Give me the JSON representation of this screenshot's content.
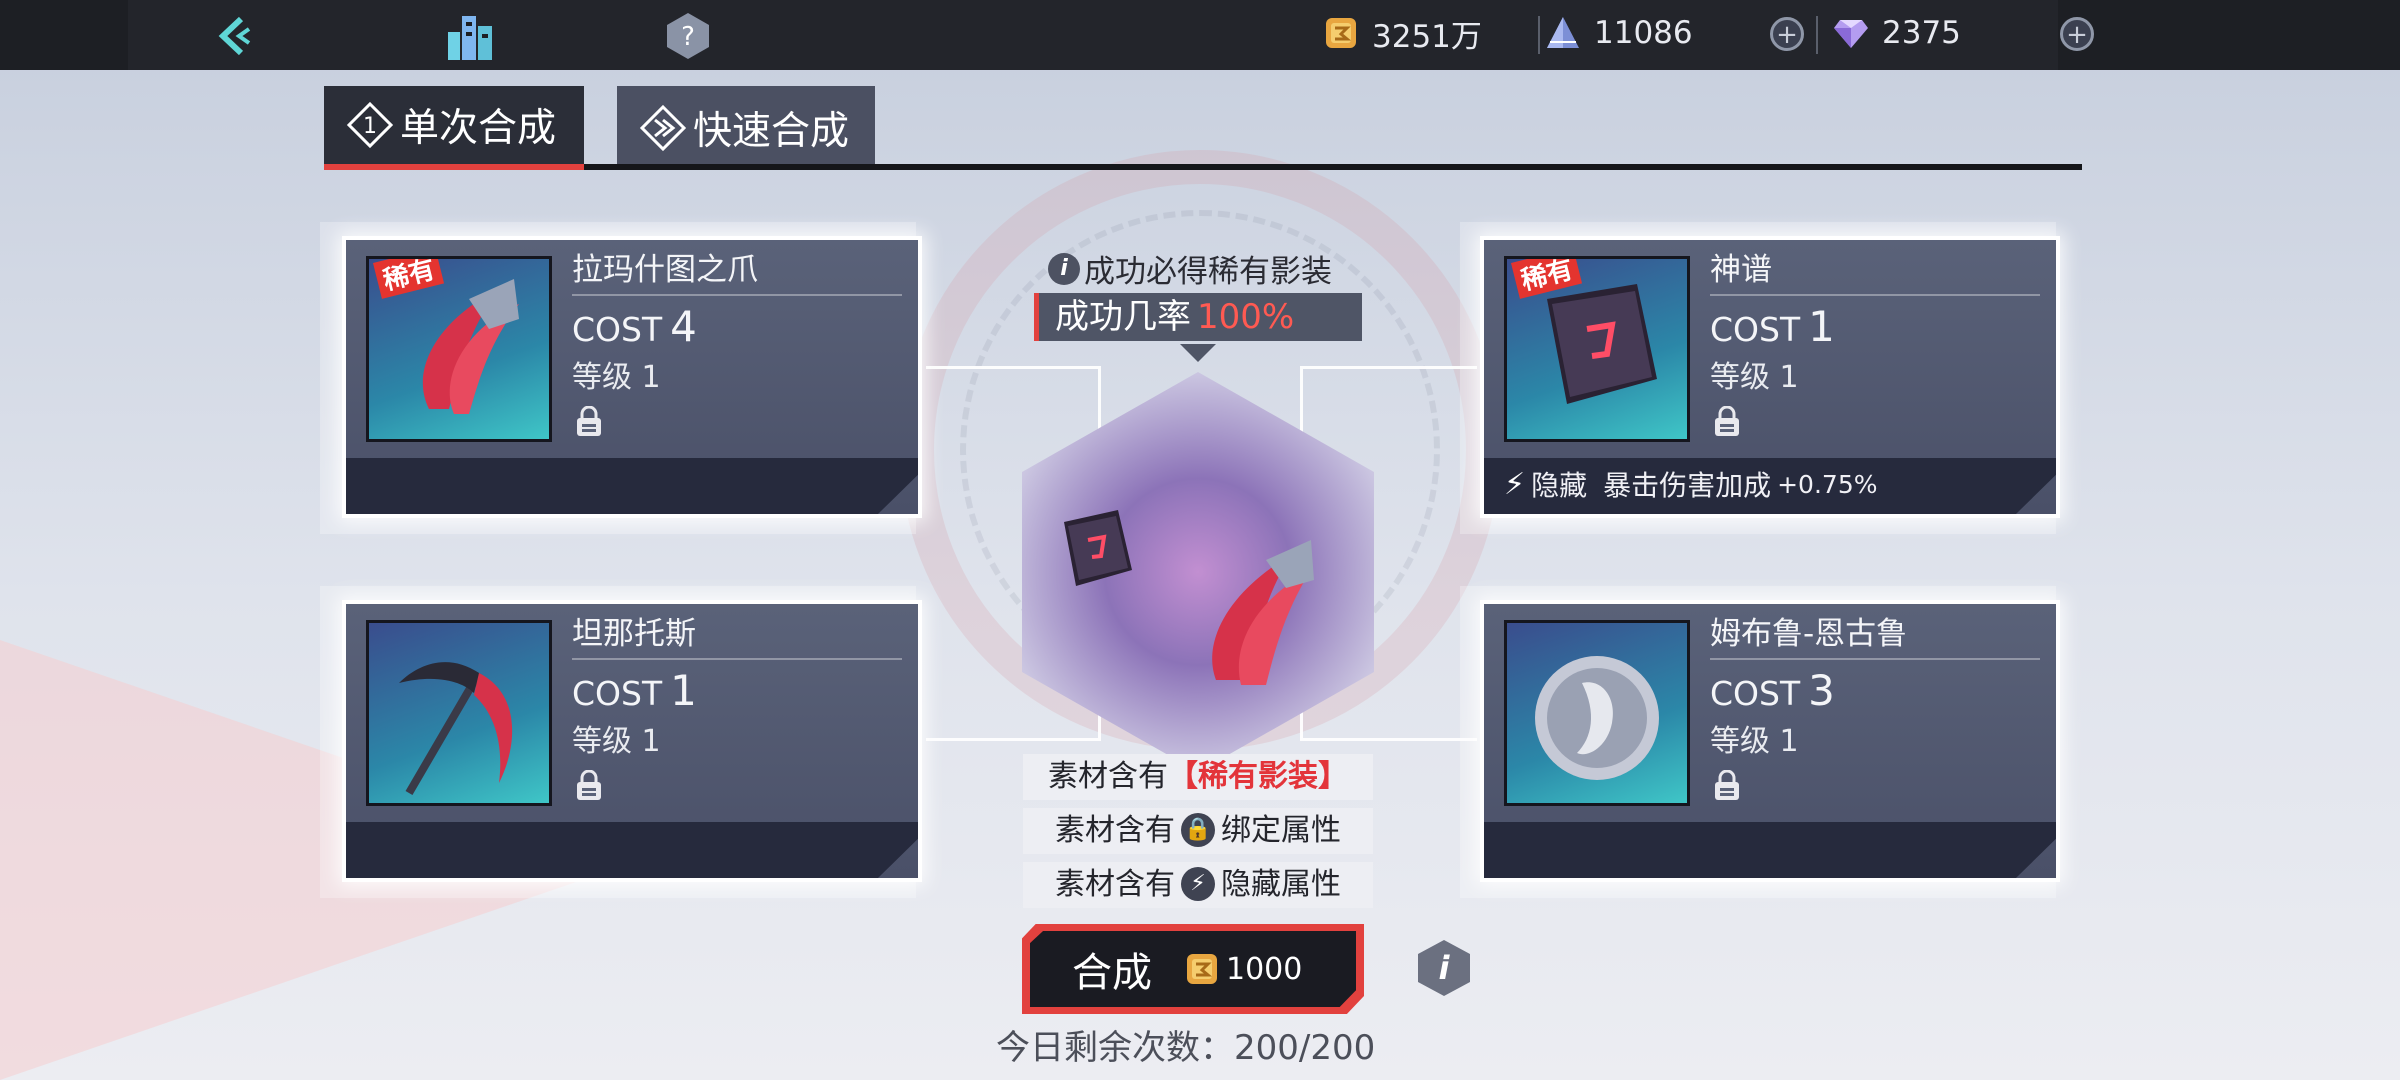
{
  "topbar": {
    "resources": [
      {
        "icon": "gold-coin-icon",
        "value": "3251万"
      },
      {
        "icon": "crystal-pyramid-icon",
        "value": "11086"
      },
      {
        "icon": "diamond-icon",
        "value": "2375"
      }
    ],
    "plus_label": "+"
  },
  "tabs": [
    {
      "label": "单次合成",
      "icon": "single-synthesis-icon",
      "active": true
    },
    {
      "label": "快速合成",
      "icon": "quick-synthesis-icon",
      "active": false
    }
  ],
  "cards": [
    {
      "name": "拉玛什图之爪",
      "cost_label": "COST",
      "cost": "4",
      "level": "等级 1",
      "rare_tag": "稀有",
      "hidden_attr": null
    },
    {
      "name": "神谱",
      "cost_label": "COST",
      "cost": "1",
      "level": "等级 1",
      "rare_tag": "稀有",
      "hidden_attr": {
        "label": "隐藏",
        "desc": "暴击伤害加成",
        "value": "+0.75%"
      }
    },
    {
      "name": "坦那托斯",
      "cost_label": "COST",
      "cost": "1",
      "level": "等级 1",
      "rare_tag": null,
      "hidden_attr": null
    },
    {
      "name": "姆布鲁-恩古鲁",
      "cost_label": "COST",
      "cost": "3",
      "level": "等级 1",
      "rare_tag": null,
      "hidden_attr": null
    }
  ],
  "center": {
    "note": "成功必得稀有影装",
    "info_mark": "i",
    "rate_label": "成功几率",
    "rate_value": "100%"
  },
  "materials": [
    {
      "prefix": "素材含有",
      "highlight": "【稀有影装】"
    },
    {
      "prefix": "素材含有",
      "icon": "lock-icon",
      "text": "绑定属性"
    },
    {
      "prefix": "素材含有",
      "icon": "lightning-icon",
      "text": "隐藏属性"
    }
  ],
  "synthesize": {
    "label": "合成",
    "cost": "1000"
  },
  "info_button": "i",
  "remaining": "今日剩余次数：200/200",
  "colors": {
    "accent": "#e2413e",
    "rare": "#e3343a",
    "card_bg": "#4a5068"
  }
}
